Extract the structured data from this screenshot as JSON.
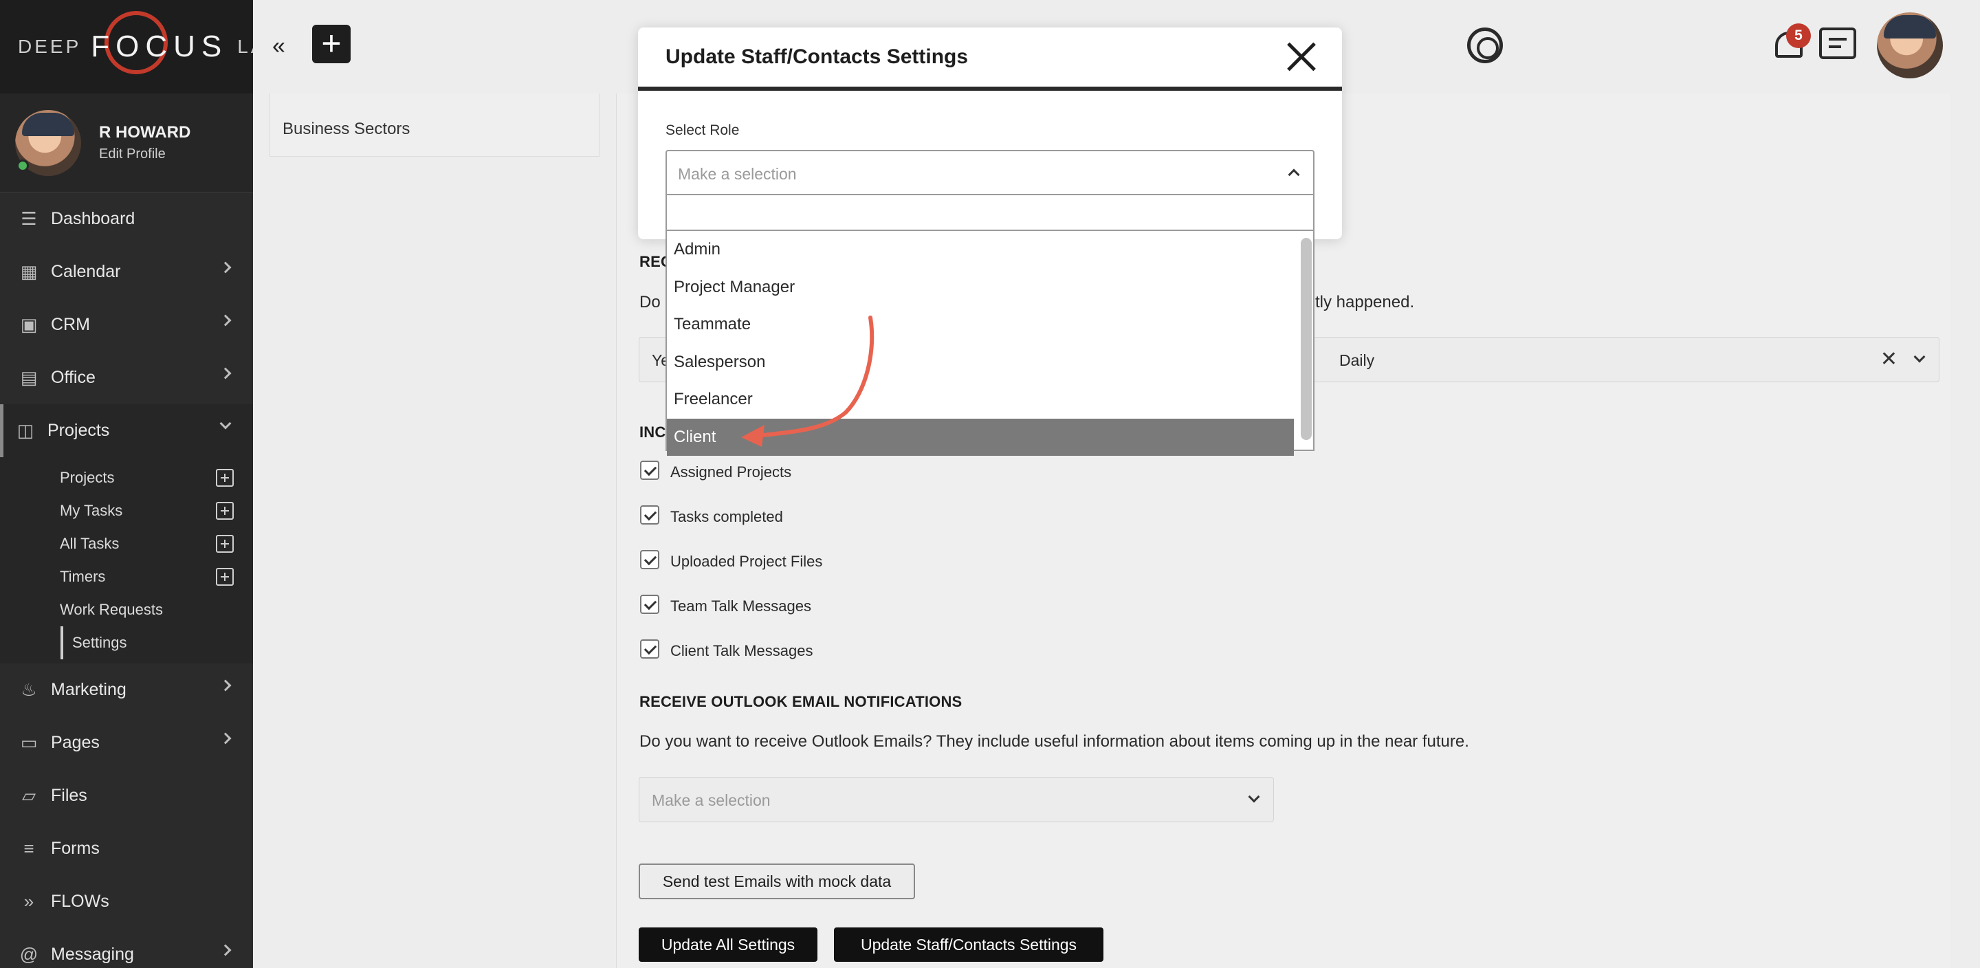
{
  "brand": {
    "left": "DEEP",
    "middle": "FOCUS",
    "right": "LABS"
  },
  "profile": {
    "name": "R HOWARD",
    "link": "Edit Profile"
  },
  "nav": {
    "dashboard": "Dashboard",
    "calendar": "Calendar",
    "crm": "CRM",
    "office": "Office",
    "projects": "Projects",
    "marketing": "Marketing",
    "pages": "Pages",
    "files": "Files",
    "forms": "Forms",
    "flows": "FLOWs",
    "messaging": "Messaging"
  },
  "projects_sub": [
    "Projects",
    "My Tasks",
    "All Tasks",
    "Timers",
    "Work Requests",
    "Settings"
  ],
  "topbar": {
    "notification_count": "5"
  },
  "left_panel": {
    "item": "Business Sectors"
  },
  "main": {
    "sec1_head_partial": "REC",
    "sec1_desc_start": "Do",
    "sec1_desc_end": "tly happened.",
    "select1_prefix": "Ye",
    "select1_value": "Daily",
    "sec2_head_partial": "INC",
    "checkboxes": [
      "Assigned Projects",
      "Tasks completed",
      "Uploaded Project Files",
      "Team Talk Messages",
      "Client Talk Messages"
    ],
    "outlook_heading": "RECEIVE OUTLOOK EMAIL NOTIFICATIONS",
    "outlook_desc": "Do you want to receive Outlook Emails? They include useful information about items coming up in the near future.",
    "outlook_placeholder": "Make a selection",
    "test_button": "Send test Emails with mock data",
    "update_all_button": "Update All Settings",
    "update_staff_button": "Update Staff/Contacts Settings"
  },
  "modal": {
    "title": "Update Staff/Contacts Settings",
    "role_label": "Select Role",
    "role_placeholder": "Make a selection",
    "options": [
      "Admin",
      "Project Manager",
      "Teammate",
      "Salesperson",
      "Freelancer",
      "Client"
    ],
    "highlighted": "Client"
  },
  "colors": {
    "highlight": "#7a7a7a",
    "arrow": "#e8634f",
    "badge": "#c0392b"
  }
}
